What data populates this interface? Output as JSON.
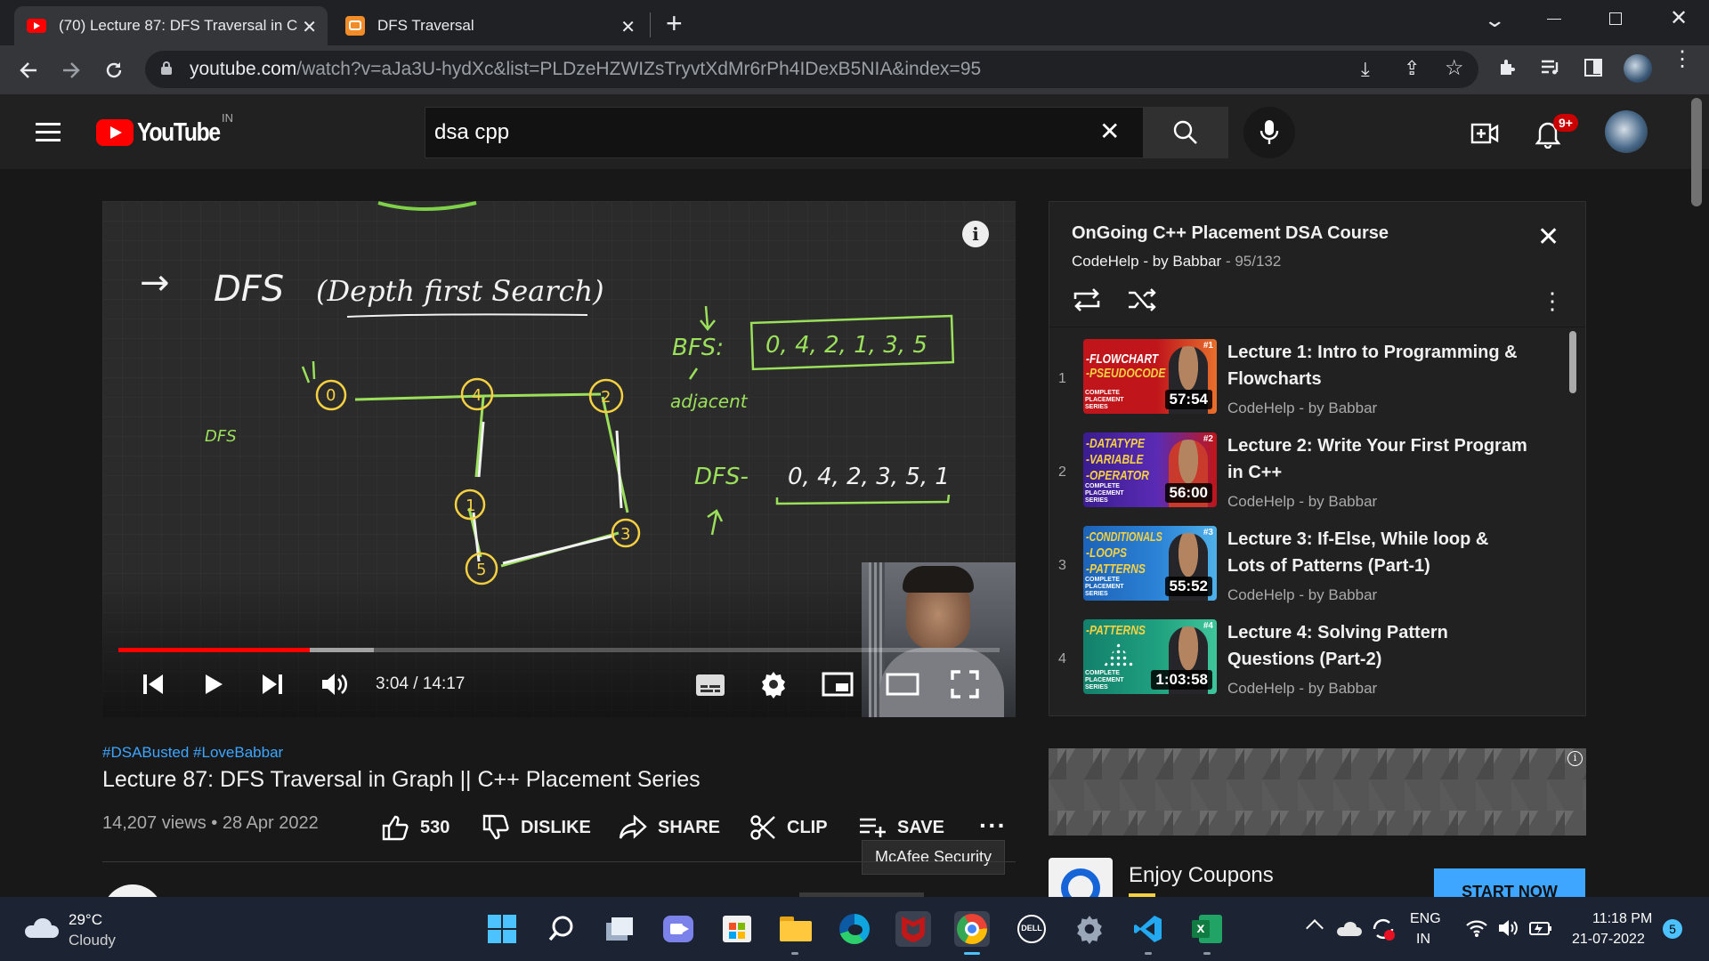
{
  "browser": {
    "tabs": [
      {
        "title": "(70) Lecture 87: DFS Traversal in C"
      },
      {
        "title": "DFS Traversal"
      }
    ],
    "url_domain": "youtube.com",
    "url_path": "/watch?v=aJa3U-hydXc&list=PLDzeHZWIZsTryvtXdMr6rPh4IDexB5NIA&index=95"
  },
  "yt": {
    "logo_text": "YouTube",
    "region": "IN",
    "search_value": "dsa cpp",
    "notif_badge": "9+"
  },
  "player": {
    "time": "3:04 / 14:17",
    "progress": 0.217,
    "buffered": 0.29,
    "board": {
      "heading_arrow": "→",
      "heading": "DFS",
      "heading_sub": "(Depth first Search)",
      "bfs_label": "BFS:",
      "bfs_value": "0, 4, 2, 1, 3, 5",
      "dfs_label": "DFS-",
      "dfs_value": "0, 4, 2, 3, 5, 1",
      "adjacent": "adjacent",
      "side_note": "DFS",
      "nodes": [
        "0",
        "4",
        "2",
        "1",
        "3",
        "5"
      ]
    }
  },
  "playlist": {
    "title": "OnGoing C++ Placement DSA Course",
    "channel": "CodeHelp - by Babbar",
    "position": "95/132",
    "items": [
      {
        "index": "1",
        "title": "Lecture 1: Intro to Programming & Flowcharts",
        "channel": "CodeHelp - by Babbar",
        "duration": "57:54",
        "thumb_lines": [
          "-FLOWCHART",
          "-PSEUDOCODE"
        ],
        "thumb_colors": [
          "#c0161b",
          "#f5d142"
        ],
        "thumb_num": "#1"
      },
      {
        "index": "2",
        "title": "Lecture 2: Write Your First Program in C++",
        "channel": "CodeHelp - by Babbar",
        "duration": "56:00",
        "thumb_lines": [
          "-DATATYPE",
          "-VARIABLE",
          "-OPERATOR"
        ],
        "thumb_colors": [
          "#3b1d8f",
          "#f5d142"
        ],
        "thumb_num": "#2"
      },
      {
        "index": "3",
        "title": "Lecture 3: If-Else, While loop & Lots of Patterns (Part-1)",
        "channel": "CodeHelp - by Babbar",
        "duration": "55:52",
        "thumb_lines": [
          "-CONDITIONALS",
          "-LOOPS",
          "-PATTERNS"
        ],
        "thumb_colors": [
          "#1d63b7",
          "#f5d142"
        ],
        "thumb_num": "#3"
      },
      {
        "index": "4",
        "title": "Lecture 4: Solving Pattern Questions (Part-2)",
        "channel": "CodeHelp - by Babbar",
        "duration": "1:03:58",
        "thumb_lines": [
          "-PATTERNS"
        ],
        "thumb_colors": [
          "#13806b",
          "#f5d142"
        ],
        "thumb_num": "#4"
      }
    ],
    "thumb_badge": "COMPLETE PLACEMENT SERIES"
  },
  "video": {
    "hashtags": "#DSABusted #LoveBabbar",
    "title": "Lecture 87: DFS Traversal in Graph || C++ Placement Series",
    "meta": "14,207 views • 28 Apr 2022",
    "likes": "530",
    "dislike": "DISLIKE",
    "share": "SHARE",
    "clip": "CLIP",
    "save": "SAVE",
    "tooltip": "McAfee Security"
  },
  "ad": {
    "title": "Enjoy Coupons",
    "cta": "START NOW"
  },
  "taskbar": {
    "temp": "29°C",
    "weather": "Cloudy",
    "lang1": "ENG",
    "lang2": "IN",
    "time": "11:18 PM",
    "date": "21-07-2022",
    "notif_count": "5"
  },
  "colors": {
    "yt_red": "#ff0000",
    "board_green": "#9be05b",
    "link_blue": "#3ea6ff",
    "ad_blue": "#065fd4"
  }
}
